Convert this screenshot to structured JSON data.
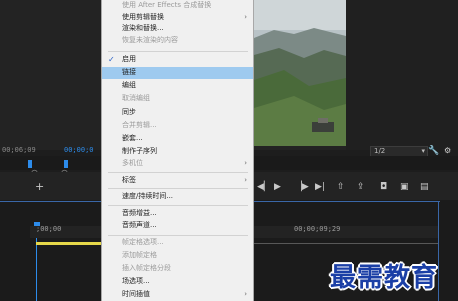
{
  "app": {
    "source_timecode": "00;06;09",
    "program_timecode": "00;00;0",
    "zoom_value": "1/2",
    "ruler_timecode_start": ";00;00",
    "ruler_timecode_mid": "00;00;09;29"
  },
  "context_menu": {
    "items": [
      {
        "label": "使用 After Effects 合成替换",
        "disabled": true
      },
      {
        "label": "使用剪辑替换",
        "submenu": true
      },
      {
        "label": "渲染和替换..."
      },
      {
        "label": "恢复未渲染的内容",
        "disabled": true
      },
      {
        "label": "启用",
        "checked": true
      },
      {
        "label": "链接",
        "selected": true
      },
      {
        "label": "编组"
      },
      {
        "label": "取消编组",
        "disabled": true
      },
      {
        "label": "同步"
      },
      {
        "label": "合并剪辑...",
        "disabled": true
      },
      {
        "label": "嵌套..."
      },
      {
        "label": "制作子序列"
      },
      {
        "label": "多机位",
        "disabled": true,
        "submenu": true
      },
      {
        "label": "标签",
        "submenu": true
      },
      {
        "label": "速度/持续时间..."
      },
      {
        "label": "音频增益..."
      },
      {
        "label": "音频声道..."
      },
      {
        "label": "帧定格选项...",
        "disabled": true
      },
      {
        "label": "添加帧定格",
        "disabled": true
      },
      {
        "label": "插入帧定格分段",
        "disabled": true
      },
      {
        "label": "场选项..."
      },
      {
        "label": "时间插值",
        "submenu": true
      }
    ]
  },
  "watermark": {
    "text": "最需教育"
  },
  "colors": {
    "menu_bg": "#f0f0f0",
    "highlight": "#9ecaef",
    "timecode_blue": "#2d8ceb",
    "workarea": "#e6d84a",
    "watermark": "#1b3fa6"
  }
}
